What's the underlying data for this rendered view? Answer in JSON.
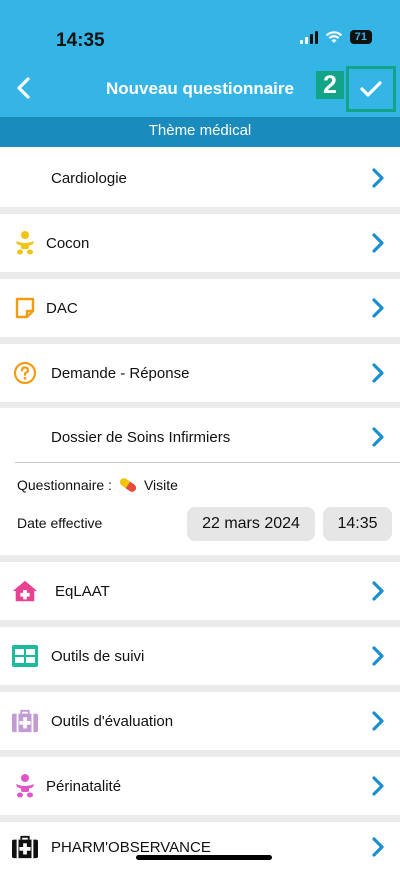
{
  "status": {
    "time": "14:35",
    "battery": "71"
  },
  "nav": {
    "title": "Nouveau questionnaire",
    "badge": "2"
  },
  "subheader": "Thème médical",
  "items": [
    {
      "label": "Cardiologie",
      "icon": "none"
    },
    {
      "label": "Cocon",
      "icon": "baby-icon"
    },
    {
      "label": "DAC",
      "icon": "note-icon"
    },
    {
      "label": "Demande - Réponse",
      "icon": "question-icon"
    },
    {
      "label": "Dossier de Soins Infirmiers",
      "icon": "none"
    },
    {
      "label": "EqLAAT",
      "icon": "house-plus-icon"
    },
    {
      "label": "Outils de suivi",
      "icon": "grid-icon"
    },
    {
      "label": "Outils d'évaluation",
      "icon": "medical-bag-icon"
    },
    {
      "label": "Périnatalité",
      "icon": "baby-icon"
    },
    {
      "label": "PHARM'OBSERVANCE",
      "icon": "medical-bag-icon"
    }
  ],
  "info": {
    "questionnaire_label": "Questionnaire :",
    "questionnaire_value": "Visite",
    "date_label": "Date effective",
    "date_value": "22 mars 2024",
    "time_value": "14:35"
  },
  "colors": {
    "header": "#35b5e6",
    "subheader": "#1a8bbd",
    "chevron": "#1a8fcf",
    "badge": "#13a386"
  }
}
